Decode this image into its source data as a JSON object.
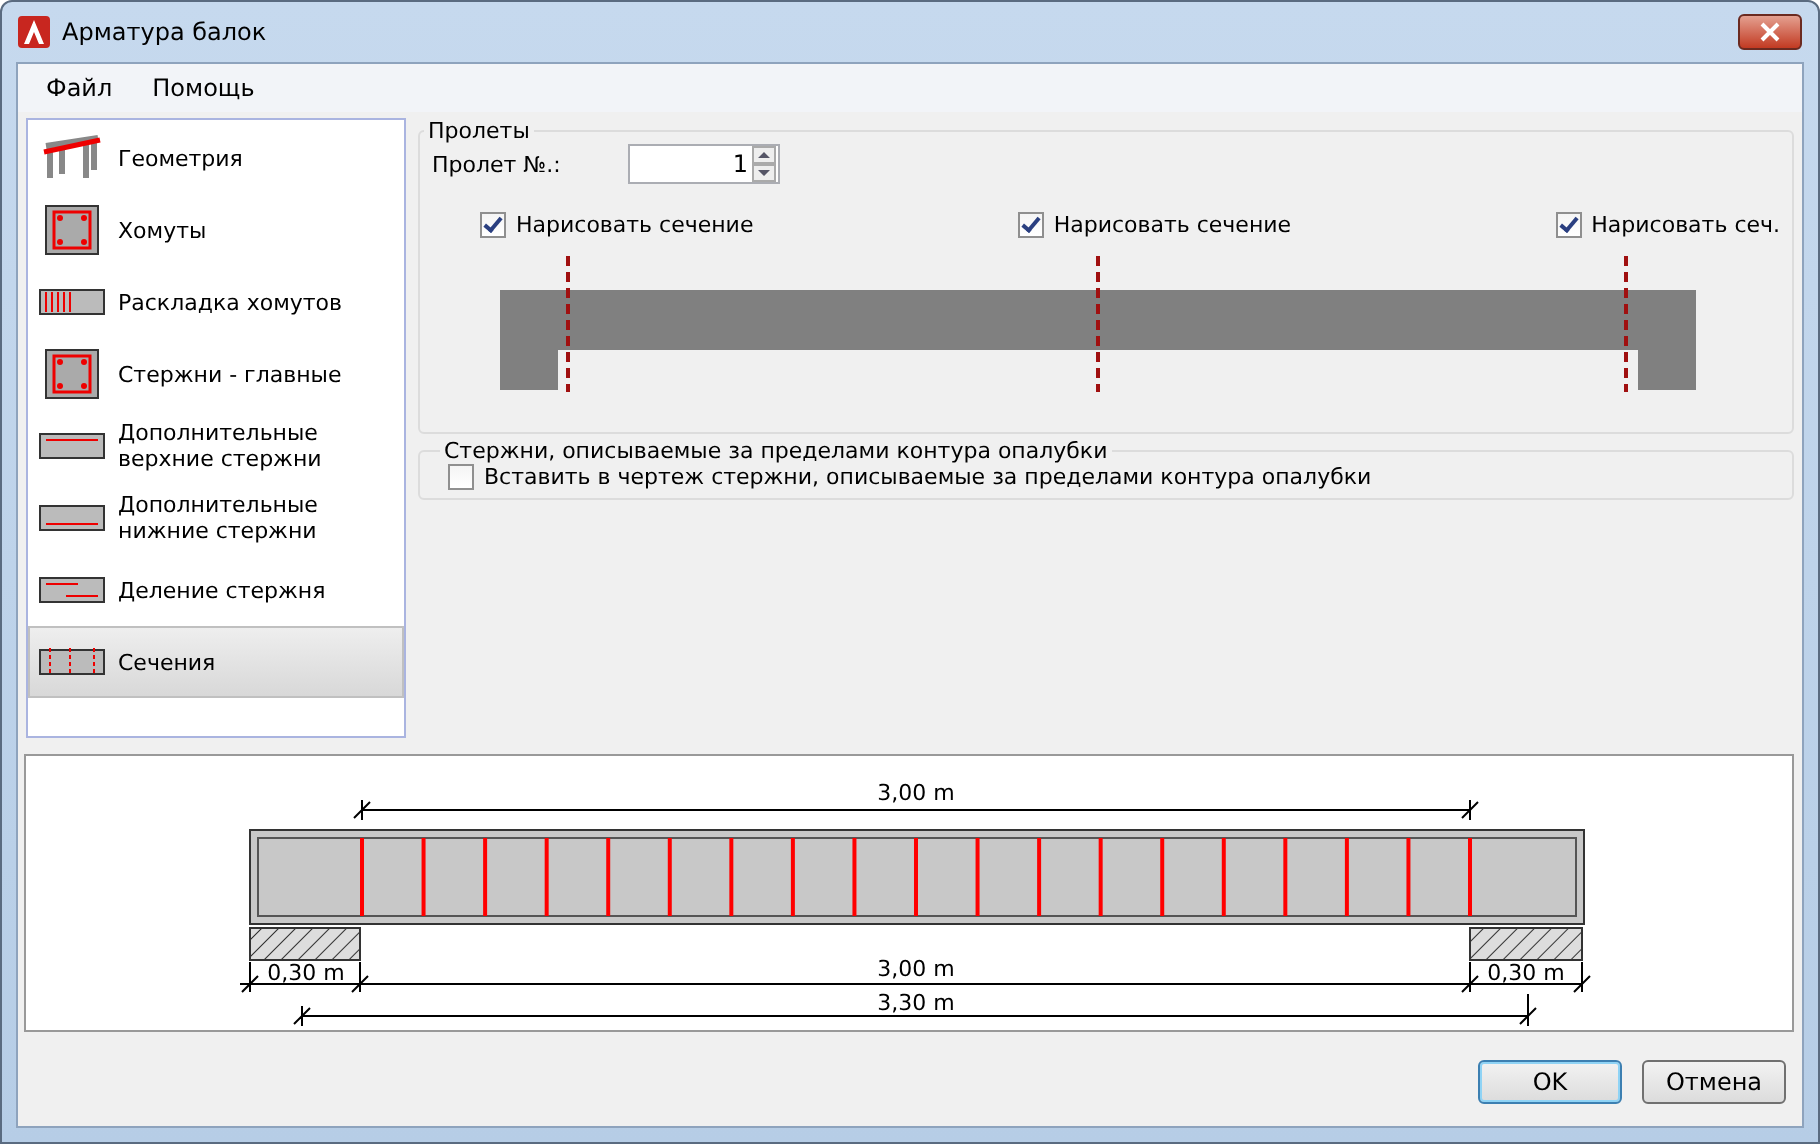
{
  "window": {
    "title": "Арматура балок"
  },
  "menu": [
    "Файл",
    "Помощь"
  ],
  "sidebar": {
    "items": [
      {
        "label": "Геометрия",
        "selected": false
      },
      {
        "label": "Хомуты",
        "selected": false
      },
      {
        "label": "Раскладка хомутов",
        "selected": false
      },
      {
        "label": "Стержни - главные",
        "selected": false
      },
      {
        "label": "Дополнительные верхние стержни",
        "selected": false
      },
      {
        "label": "Дополнительные нижние стержни",
        "selected": false
      },
      {
        "label": "Деление стержня",
        "selected": false
      },
      {
        "label": "Сечения",
        "selected": true
      }
    ]
  },
  "spans": {
    "title": "Пролеты",
    "span_label": "Пролет №.:",
    "span_value": "1",
    "sections": [
      {
        "label": "Нарисовать сечение",
        "checked": true
      },
      {
        "label": "Нарисовать сечение",
        "checked": true
      },
      {
        "label": "Нарисовать сеч.",
        "checked": true
      }
    ]
  },
  "outside_bars": {
    "title": "Стержни, описываемые за пределами контура опалубки",
    "option": {
      "label": "Вставить в чертеж стержни, описываемые за пределами контура опалубки",
      "checked": false
    }
  },
  "preview": {
    "top_dimension": "3,00 m",
    "left_support": "0,30 m",
    "clear_span": "3,00 m",
    "right_support": "0,30 m",
    "total_length": "3,30 m"
  },
  "buttons": [
    "OK",
    "Отмена"
  ]
}
